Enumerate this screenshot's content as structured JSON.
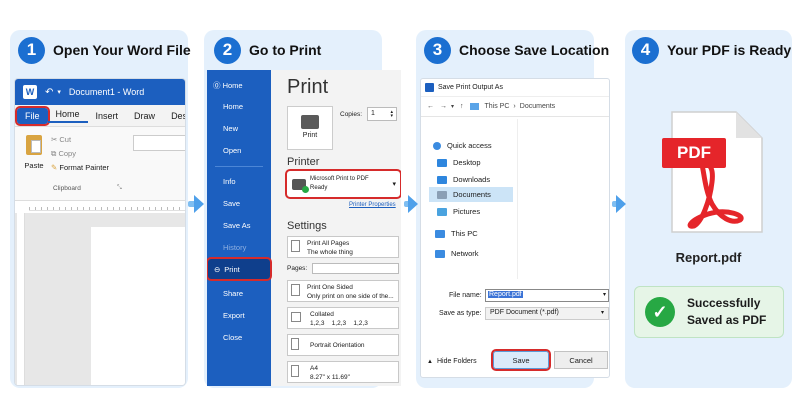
{
  "steps": [
    {
      "num": "1",
      "title": "Open Your Word File"
    },
    {
      "num": "2",
      "title": "Go to Print"
    },
    {
      "num": "3",
      "title": "Choose Save Location"
    },
    {
      "num": "4",
      "title": "Your PDF is Ready"
    }
  ],
  "word": {
    "doc_title": "Document1 - Word",
    "app_letter": "W",
    "tabs": [
      "File",
      "Home",
      "Insert",
      "Draw",
      "Design"
    ],
    "paste": "Paste",
    "cut": "Cut",
    "copy": "Copy",
    "format_painter": "Format Painter",
    "clipboard": "Clipboard"
  },
  "backstage": {
    "items": [
      "Home",
      "Home",
      "New",
      "Open",
      "Info",
      "Save",
      "Save As",
      "History",
      "Print",
      "Share",
      "Export",
      "Close"
    ],
    "print_title": "Print",
    "print_btn": "Print",
    "copies_label": "Copies:",
    "copies_value": "1",
    "printer_heading": "Printer",
    "printer_name": "Microsoft Print to PDF",
    "printer_status": "Ready",
    "printer_props": "Printer Properties",
    "settings_heading": "Settings",
    "s1a": "Print All Pages",
    "s1b": "The whole thing",
    "pages_label": "Pages:",
    "s2a": "Print One Sided",
    "s2b": "Only print on one side of the...",
    "s3a": "Collated",
    "s3b": "1,2,3    1,2,3    1,2,3",
    "s4a": "Portrait Orientation",
    "s5a": "A4",
    "s5b": "8.27\" x 11.69\""
  },
  "dialog": {
    "title": "Save Print Output As",
    "crumb1": "This PC",
    "crumb2": "Documents",
    "sidebar": [
      "Quick access",
      "Desktop",
      "Downloads",
      "Documents",
      "Pictures",
      "This PC",
      "Network"
    ],
    "file_name_label": "File name:",
    "file_name_value": "Report.pdf",
    "save_type_label": "Save as type:",
    "save_type_value": "PDF Document (*.pdf)",
    "hide_folders": "Hide Folders",
    "save": "Save",
    "cancel": "Cancel"
  },
  "result": {
    "badge": "PDF",
    "filename": "Report.pdf",
    "success_line1": "Successfully",
    "success_line2": "Saved as PDF"
  },
  "colors": {
    "accent": "#1b6fd1",
    "word_blue": "#1c5fbf",
    "pdf_red": "#e5252a",
    "success": "#27a844",
    "highlight": "#d62b2b"
  }
}
